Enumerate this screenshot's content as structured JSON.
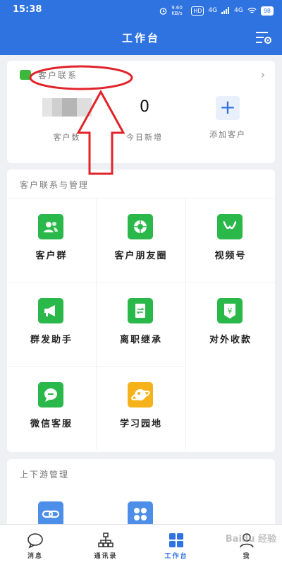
{
  "status": {
    "time": "15:38",
    "net_speed": "9.60 KB/s",
    "hd": "HD",
    "signal1": "4G",
    "signal2": "4G",
    "battery": "98"
  },
  "header": {
    "title": "工作台"
  },
  "customer_card": {
    "title": "客户联系",
    "stats": [
      {
        "label": "客户数",
        "value": ""
      },
      {
        "label": "今日新增",
        "value": "0"
      },
      {
        "label": "添加客户",
        "button": "+"
      }
    ]
  },
  "management": {
    "title": "客户联系与管理",
    "items": [
      {
        "label": "客户群",
        "icon": "group-icon",
        "color": "#2bb84a"
      },
      {
        "label": "客户朋友圈",
        "icon": "moments-shutter-icon",
        "color": "#2bb84a"
      },
      {
        "label": "视频号",
        "icon": "channels-icon",
        "color": "#2bb84a"
      },
      {
        "label": "群发助手",
        "icon": "megaphone-icon",
        "color": "#2bb84a"
      },
      {
        "label": "离职继承",
        "icon": "transfer-doc-icon",
        "color": "#2bb84a"
      },
      {
        "label": "对外收款",
        "icon": "yuan-receipt-icon",
        "color": "#2bb84a"
      },
      {
        "label": "微信客服",
        "icon": "chat-bubble-icon",
        "color": "#2bb84a"
      },
      {
        "label": "学习园地",
        "icon": "planet-icon",
        "color": "#f6b21a"
      }
    ]
  },
  "upstream": {
    "title": "上下游管理",
    "items": [
      {
        "icon": "link-icon",
        "color": "#4d8fe8"
      },
      {
        "icon": "apps-grid-icon",
        "color": "#4d8fe8"
      }
    ]
  },
  "tabs": [
    {
      "label": "消息",
      "icon": "message-icon"
    },
    {
      "label": "通讯录",
      "icon": "org-chart-icon"
    },
    {
      "label": "工作台",
      "icon": "workbench-grid-icon",
      "active": true
    },
    {
      "label": "我",
      "icon": "person-icon"
    }
  ],
  "watermark": "Baidu 经验",
  "colors": {
    "brand": "#2f73e0",
    "green": "#2bb84a",
    "annotation": "#e0242a"
  }
}
